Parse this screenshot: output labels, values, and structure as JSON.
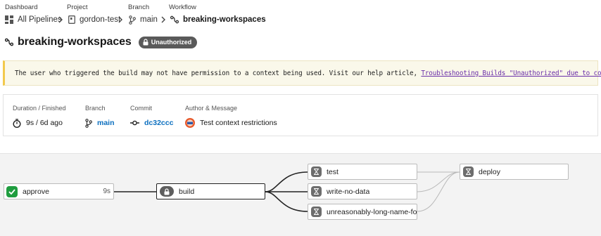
{
  "breadcrumb": {
    "labels": {
      "dashboard": "Dashboard",
      "project": "Project",
      "branch": "Branch",
      "workflow": "Workflow"
    },
    "dashboard": "All Pipelines",
    "project": "gordon-test",
    "branch": "main",
    "workflow": "breaking-workspaces"
  },
  "title": "breaking-workspaces",
  "status_badge": "Unauthorized",
  "warning": {
    "text": "The user who triggered the build may not have permission to a context being used. Visit our help article, ",
    "link": "Troubleshooting Builds \"Unauthorized\" due to contexts",
    "end": "."
  },
  "info": {
    "duration": {
      "label": "Duration / Finished",
      "value": "9s / 6d ago"
    },
    "branch": {
      "label": "Branch",
      "value": "main"
    },
    "commit": {
      "label": "Commit",
      "value": "dc32ccc"
    },
    "author": {
      "label": "Author & Message",
      "value": "Test context restrictions"
    }
  },
  "jobs": {
    "approve": {
      "name": "approve",
      "duration": "9s",
      "status": "success"
    },
    "build": {
      "name": "build",
      "status": "unauthorized"
    },
    "test": {
      "name": "test",
      "status": "queued"
    },
    "write_no_data": {
      "name": "write-no-data",
      "status": "queued"
    },
    "unreasonably": {
      "name": "unreasonably-long-name-fo...",
      "status": "queued"
    },
    "deploy": {
      "name": "deploy",
      "status": "queued"
    }
  },
  "colors": {
    "success": "#1f9d3f",
    "link": "#0b6fbf",
    "warning": "#f2c94c",
    "help_link": "#6a2ea8"
  },
  "icons": {
    "dashboard": "grid-icon",
    "project": "repo-icon",
    "branch": "git-branch-icon",
    "workflow": "workflow-icon",
    "duration": "stopwatch-icon",
    "commit": "git-commit-icon",
    "queued": "hourglass-icon",
    "lock": "lock-icon",
    "success": "checkmark-icon",
    "warning": "warning-icon"
  }
}
